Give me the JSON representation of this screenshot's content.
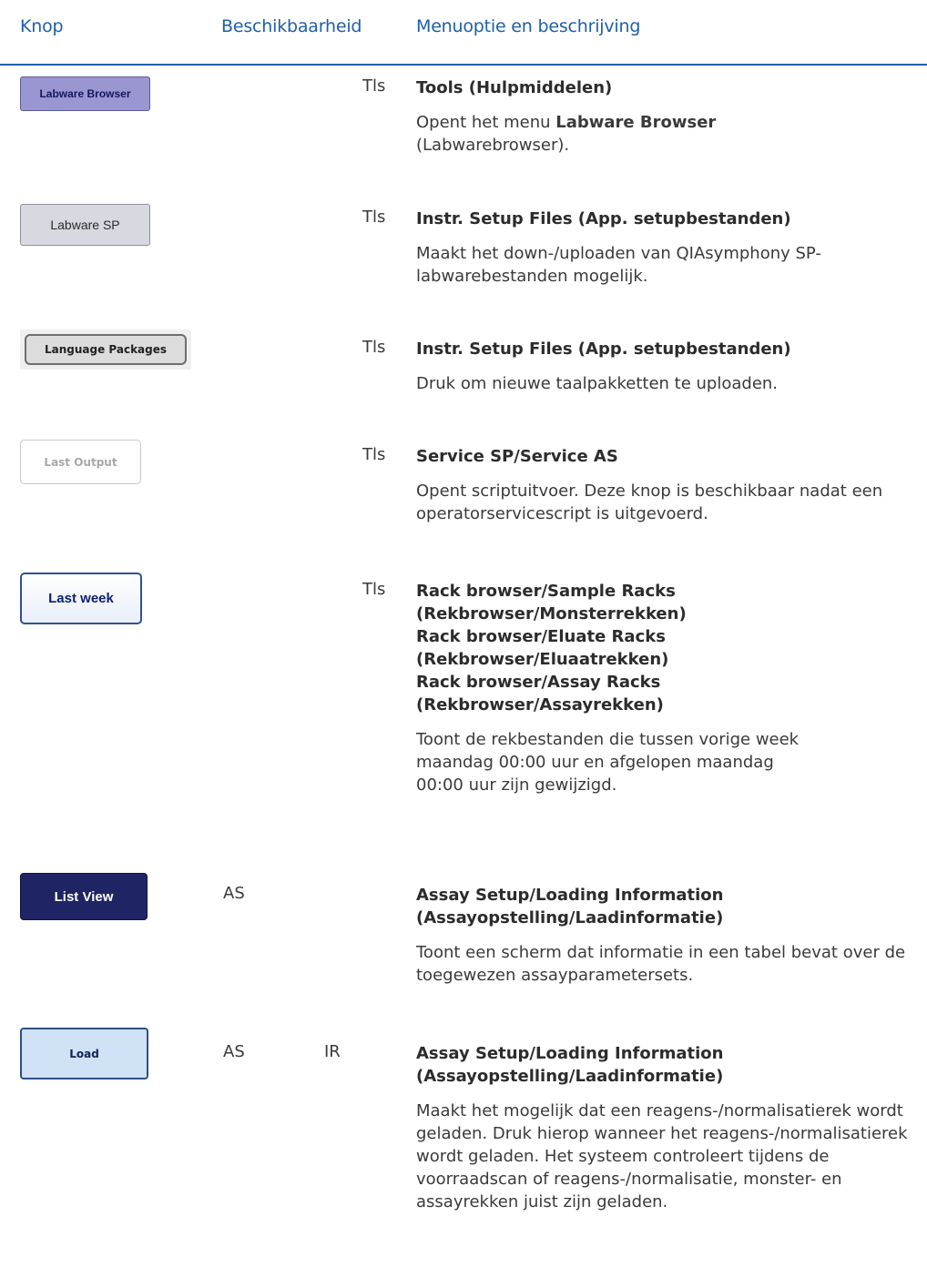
{
  "header": {
    "col_knop": "Knop",
    "col_beschikbaarheid": "Beschikbaarheid",
    "col_menu": "Menuoptie en beschrijving"
  },
  "rows": [
    {
      "button": "Labware Browser",
      "avail_a": "",
      "avail_b": "",
      "avail_c": "Tls",
      "title_lines": [
        "Tools (Hulpmiddelen)"
      ],
      "desc_pre": "Opent het menu ",
      "desc_bold": "Labware Browser",
      "desc_post": " (Labwarebrowser)."
    },
    {
      "button": "Labware SP",
      "avail_a": "",
      "avail_b": "",
      "avail_c": "Tls",
      "title_lines": [
        "Instr. Setup Files (App. setupbestanden)"
      ],
      "desc": "Maakt het down-/uploaden van QIAsymphony SP-labwarebestanden mogelijk."
    },
    {
      "button": "Language Packages",
      "avail_a": "",
      "avail_b": "",
      "avail_c": "Tls",
      "title_lines": [
        "Instr. Setup Files (App. setupbestanden)"
      ],
      "desc": "Druk om nieuwe taalpakketten te uploaden."
    },
    {
      "button": "Last Output",
      "avail_a": "",
      "avail_b": "",
      "avail_c": "Tls",
      "title_lines": [
        "Service SP/Service AS"
      ],
      "desc": "Opent scriptuitvoer. Deze knop is beschikbaar nadat een operatorservicescript is uitgevoerd."
    },
    {
      "button": "Last week",
      "avail_a": "",
      "avail_b": "",
      "avail_c": "Tls",
      "title_lines": [
        "Rack browser/Sample Racks",
        "(Rekbrowser/Monsterrekken)",
        "Rack browser/Eluate Racks",
        "(Rekbrowser/Eluaatrekken)",
        "Rack browser/Assay Racks",
        "(Rekbrowser/Assayrekken)"
      ],
      "desc": "Toont de rekbestanden die tussen vorige week maandag 00:00 uur en afgelopen maandag 00:00 uur zijn gewijzigd."
    },
    {
      "button": "List View",
      "avail_a": "AS",
      "avail_b": "",
      "avail_c": "",
      "title_lines": [
        "Assay Setup/Loading Information",
        "(Assayopstelling/Laadinformatie)"
      ],
      "desc": "Toont een scherm dat informatie in een tabel bevat over de toegewezen assayparametersets."
    },
    {
      "button": "Load",
      "avail_a": "AS",
      "avail_b": "IR",
      "avail_c": "",
      "title_lines": [
        "Assay Setup/Loading Information",
        "(Assayopstelling/Laadinformatie)"
      ],
      "desc": "Maakt het mogelijk dat een reagens-/normalisatierek wordt geladen. Druk hierop wanneer het reagens-/normalisatierek wordt geladen. Het systeem controleert tijdens de voorraadscan of reagens-/normalisatie, monster- en assayrekken juist zijn geladen."
    }
  ]
}
